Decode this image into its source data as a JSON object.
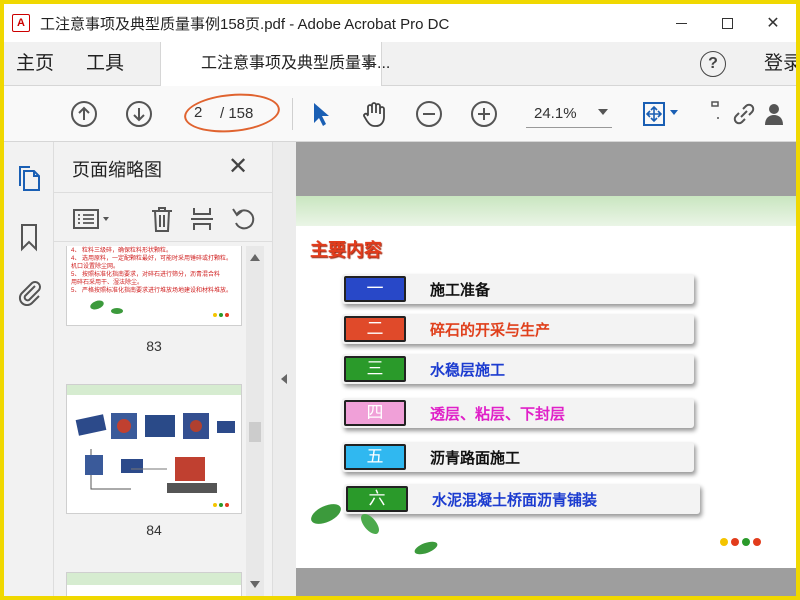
{
  "window": {
    "title": "工注意事项及典型质量事例158页.pdf - Adobe Acrobat Pro DC",
    "app_icon_glyph": "A",
    "minimize_label": "",
    "close_label": "✕"
  },
  "menu": {
    "home": "主页",
    "tools": "工具",
    "doc_tab": "工注意事项及典型质量事...",
    "doc_tab_close": "×",
    "help": "?",
    "login": "登录"
  },
  "toolbar": {
    "page_current": "2",
    "page_total": "/ 158",
    "zoom": "24.1%",
    "icons": [
      "arrow-up-circle-icon",
      "arrow-down-circle-icon",
      "pointer-icon",
      "hand-icon",
      "zoom-out-icon",
      "zoom-in-icon",
      "fit-page-icon",
      "link-icon",
      "share-user-icon"
    ],
    "accent": "#1a5fb4",
    "highlight_ellipse_color": "#e0632f"
  },
  "sidebar": {
    "title": "页面缩略图",
    "close": "✕",
    "thumbnails": [
      {
        "page": "83",
        "lines": [
          "4、 粒料三级碎，确保粒料形状颗粒。",
          "4、 选用原料，一定配颗粒最好，可能时采用锤碎或打颗粒。",
          "   机口设置除尘网。",
          "5、 按照标准化指南要求，对碎石进行筛分，沥青混合料",
          "   用碎石采用干、湿法除尘。",
          "5、 严格按照标准化指南要求进行堆放场地建设和材料堆放。"
        ]
      },
      {
        "page": "84"
      },
      {
        "page": ""
      }
    ]
  },
  "document": {
    "title": "主要内容",
    "rows": [
      {
        "num": "一",
        "text": "施工准备",
        "num_bg": "#2848c8",
        "text_color": "#111111"
      },
      {
        "num": "二",
        "text": "碎石的开采与生产",
        "num_bg": "#e04a2a",
        "text_color": "#e0401c"
      },
      {
        "num": "三",
        "text": "水稳层施工",
        "num_bg": "#2a9a2a",
        "text_color": "#1c3cd0"
      },
      {
        "num": "四",
        "text": "透层、粘层、下封层",
        "num_bg": "#f0a0d8",
        "text_color": "#e020c8"
      },
      {
        "num": "五",
        "text": "沥青路面施工",
        "num_bg": "#30b8f0",
        "text_color": "#111111"
      },
      {
        "num": "六",
        "text": "水泥混凝土桥面沥青铺装",
        "num_bg": "#2a9a2a",
        "text_color": "#1c3cd0"
      }
    ],
    "dot_colors": [
      "#f4c400",
      "#e23c1c",
      "#2a9a2a",
      "#e23c1c"
    ]
  }
}
